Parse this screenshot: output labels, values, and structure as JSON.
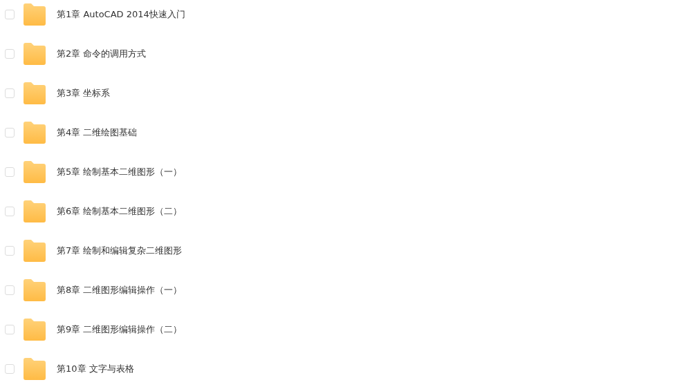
{
  "folders": [
    {
      "name": "第1章 AutoCAD 2014快速入门",
      "checked": false
    },
    {
      "name": "第2章 命令的调用方式",
      "checked": false
    },
    {
      "name": "第3章 坐标系",
      "checked": false
    },
    {
      "name": "第4章 二维绘图基础",
      "checked": false
    },
    {
      "name": "第5章 绘制基本二维图形（一）",
      "checked": false
    },
    {
      "name": "第6章 绘制基本二维图形（二）",
      "checked": false
    },
    {
      "name": "第7章 绘制和编辑复杂二维图形",
      "checked": false
    },
    {
      "name": "第8章 二维图形编辑操作（一）",
      "checked": false
    },
    {
      "name": "第9章 二维图形编辑操作（二）",
      "checked": false
    },
    {
      "name": "第10章 文字与表格",
      "checked": false
    }
  ]
}
